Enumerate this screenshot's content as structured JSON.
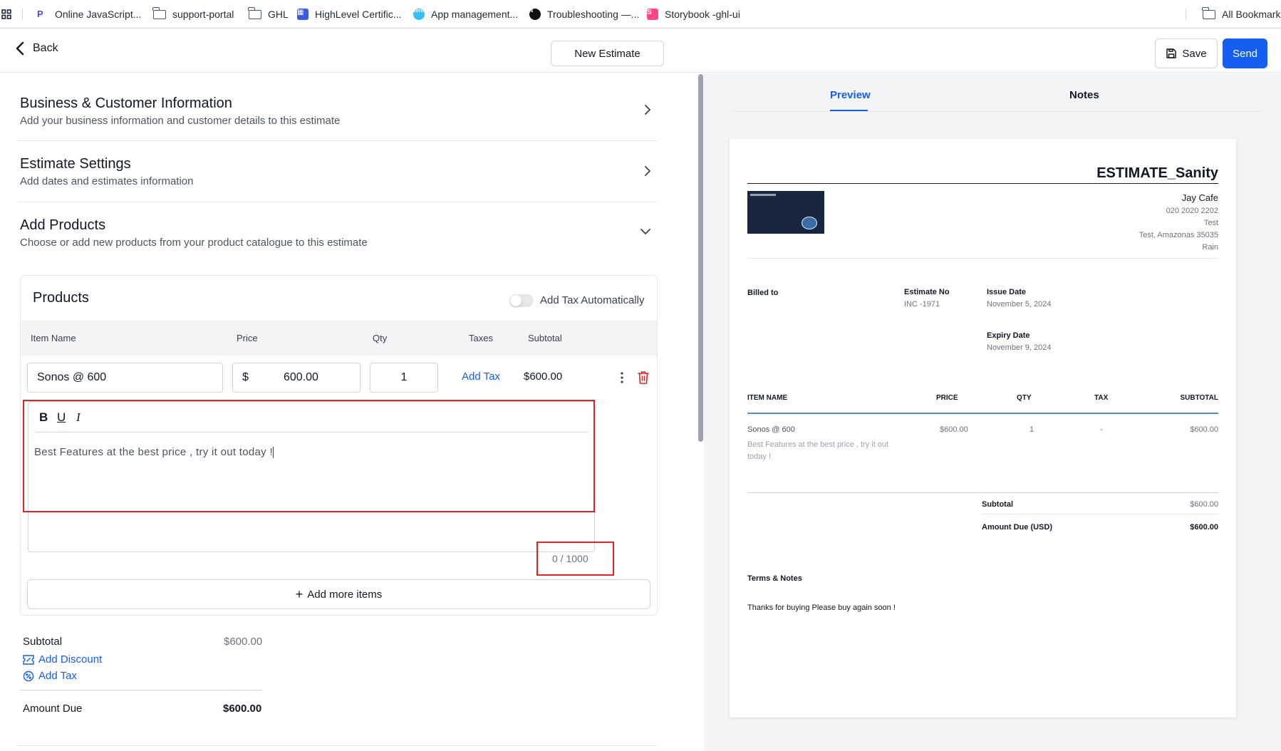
{
  "bookmarks": {
    "items": [
      {
        "label": "Online JavaScript...",
        "icon": "p-favicon"
      },
      {
        "label": "support-portal",
        "icon": "folder-icon"
      },
      {
        "label": "GHL",
        "icon": "folder-icon"
      },
      {
        "label": "HighLevel Certific...",
        "icon": "highlevel-favicon"
      },
      {
        "label": "App management...",
        "icon": "xero-favicon"
      },
      {
        "label": "Troubleshooting —...",
        "icon": "notion-favicon"
      },
      {
        "label": "Storybook -ghl-ui",
        "icon": "storybook-favicon"
      }
    ],
    "all_bookmarks": "All Bookmarks"
  },
  "header": {
    "back_label": "Back",
    "title_button": "New Estimate",
    "save_label": "Save",
    "send_label": "Send"
  },
  "sections": [
    {
      "title": "Business & Customer Information",
      "subtitle": "Add your business information and customer details to this estimate"
    },
    {
      "title": "Estimate Settings",
      "subtitle": "Add dates and estimates information"
    },
    {
      "title": "Add Products",
      "subtitle": "Choose or add new products from your product catalogue to this estimate"
    }
  ],
  "products": {
    "title": "Products",
    "tax_toggle_label": "Add Tax Automatically",
    "tax_toggle_on": false,
    "columns": [
      "Item Name",
      "Price",
      "Qty",
      "Taxes",
      "Subtotal"
    ],
    "item": {
      "name": "Sonos @ 600",
      "currency": "$",
      "price": "600.00",
      "qty": "1",
      "tax_link": "Add Tax",
      "subtotal": "$600.00",
      "description": "Best Features at the best price , try it out today !"
    },
    "char_counter": "0 / 1000",
    "add_more": "Add more items"
  },
  "totals": {
    "subtotal_label": "Subtotal",
    "subtotal_value": "$600.00",
    "add_discount": "Add Discount",
    "add_tax": "Add Tax",
    "amount_due_label": "Amount Due",
    "amount_due_value": "$600.00"
  },
  "tabs": [
    "Preview",
    "Notes"
  ],
  "preview": {
    "title": "ESTIMATE_Sanity",
    "business": {
      "name": "Jay Cafe",
      "phone": "020 2020 2202",
      "line1": "Test",
      "line2": "Test, Amazonas 35035",
      "line3": "Rain"
    },
    "billed_to_label": "Billed to",
    "estimate_no_label": "Estimate No",
    "estimate_no": "INC -1971",
    "issue_date_label": "Issue Date",
    "issue_date": "November 5, 2024",
    "expiry_date_label": "Expiry Date",
    "expiry_date": "November 9, 2024",
    "columns": [
      "ITEM NAME",
      "PRICE",
      "QTY",
      "TAX",
      "SUBTOTAL"
    ],
    "row": {
      "name": "Sonos @ 600",
      "description_line1": "Best Features at the best price , try it out",
      "description_line2": "today !",
      "price": "$600.00",
      "qty": "1",
      "tax": "-",
      "subtotal": "$600.00"
    },
    "subtotal_label": "Subtotal",
    "subtotal_value": "$600.00",
    "amount_due_label": "Amount Due (USD)",
    "amount_due_value": "$600.00",
    "terms_label": "Terms & Notes",
    "terms_text": "Thanks for buying Please buy again soon !"
  },
  "colors": {
    "accent": "#155eef",
    "highlight": "#dc2626",
    "danger": "#dc2626"
  }
}
